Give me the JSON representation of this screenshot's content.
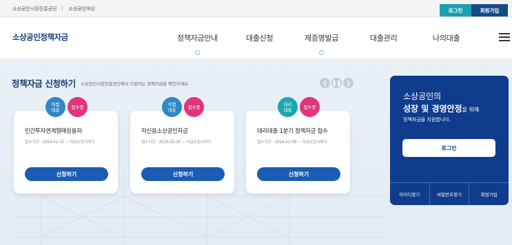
{
  "topbar": {
    "links": [
      "소상공인시장진흥공단",
      "소상공인마당"
    ],
    "login_label": "로그인",
    "join_label": "회원가입"
  },
  "header": {
    "logo": "소상공인정책자금",
    "nav": [
      "정책자금안내",
      "대출신청",
      "제증명발급",
      "대출관리",
      "나의대출"
    ]
  },
  "section": {
    "title": "정책자금 신청하기",
    "desc": "소상공인시장진흥공단에서 지원하는 정책자금을 확인하세요"
  },
  "cards": [
    {
      "type": [
        "직접",
        "대출"
      ],
      "status": "접수중",
      "title": "민간투자연계형매칭융자",
      "meta": "접수기간 : 2024-01-15 ~ 자금소진시까지",
      "apply": "신청하기"
    },
    {
      "type": [
        "직접",
        "대출"
      ],
      "status": "접수중",
      "title": "저신용소상공인자금",
      "meta": "접수기간 : 2024-02-26 ~ 자금소진시까지",
      "apply": "신청하기"
    },
    {
      "type": [
        "대리",
        "대출"
      ],
      "status": "접수중",
      "title": "대리대출 1분기 정책자금 접수",
      "meta": "접수기간 : 2024-01-08 ~ 자금소진시까지",
      "apply": "신청하기"
    }
  ],
  "panel": {
    "line1": "소상공인의",
    "line2_bold": "성장 및 경영안정",
    "line2_rest": "을 위해",
    "line3": "정책자금을 지원합니다.",
    "login": "로그인",
    "links": [
      "아이디찾기",
      "비밀번호찾기",
      "회원가입"
    ]
  },
  "colors": {
    "brand_navy": "#0f3c8c",
    "apply_blue": "#1b5cb4",
    "status_pink": "#e0357d",
    "type_blue": "#2f87c7",
    "type_teal": "#1aa8b0",
    "top_teal": "#1aa0b0"
  }
}
